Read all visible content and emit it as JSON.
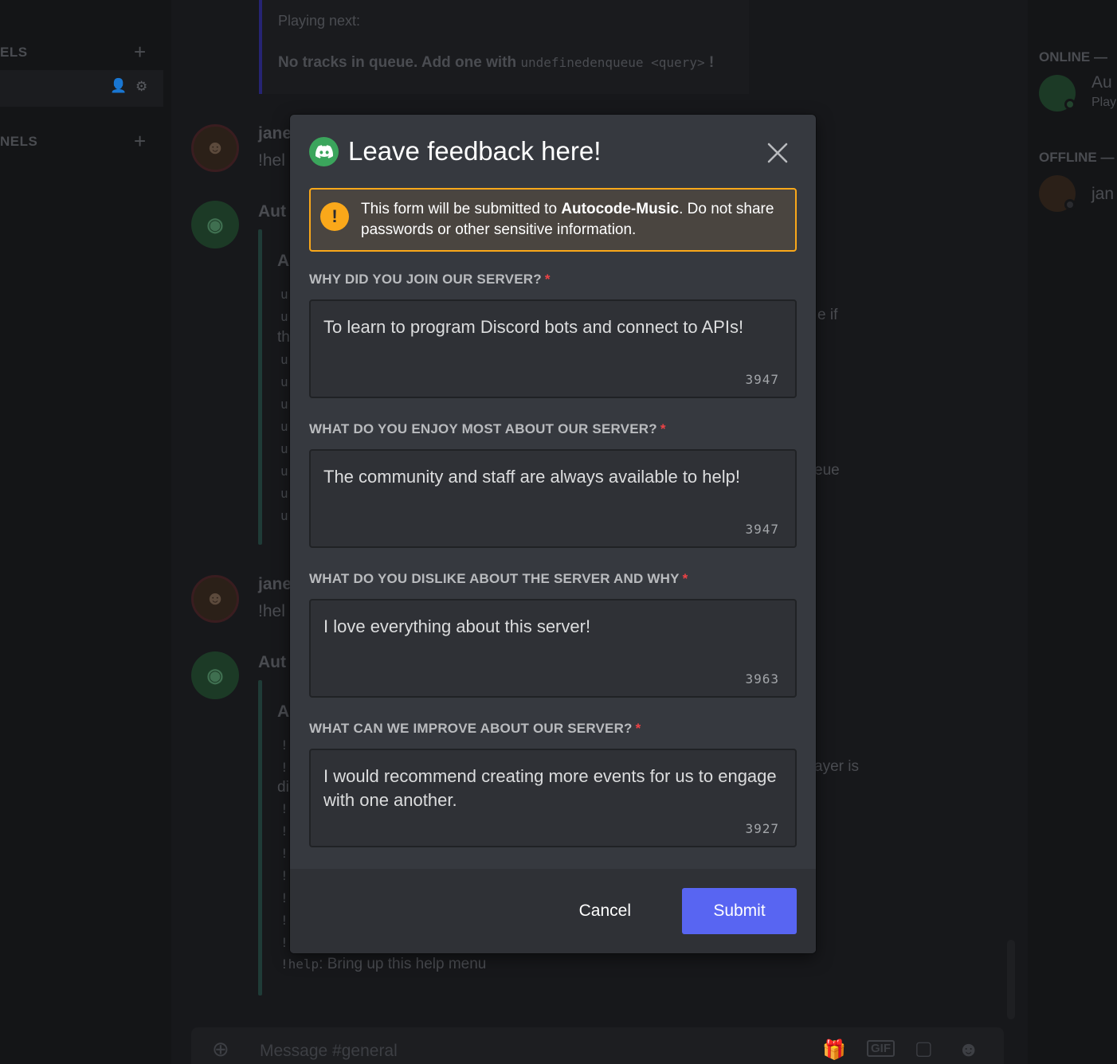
{
  "background": {
    "sidebar": {
      "category_1": "ELS",
      "category_2": "NELS"
    },
    "now_playing": {
      "label": "Playing next:",
      "queue_text": "No tracks in queue. Add one with",
      "queue_cmd": "undefinedenqueue <query>",
      "queue_end": "!"
    },
    "messages": [
      {
        "author": "jane",
        "text": "!hel"
      },
      {
        "author": "Aut",
        "text": "A"
      },
      {
        "author": "jane",
        "text": "!hel"
      },
      {
        "author": "Aut",
        "text": "A"
      }
    ],
    "side_fragments": {
      "frag_1": "e if",
      "frag_2": "eue",
      "frag_3": "ayer is",
      "frag_4": "th",
      "frag_5": "di"
    },
    "help_line": {
      "cmd": "!help",
      "text": ": Bring up this help menu"
    },
    "message_input_placeholder": "Message #general",
    "members": {
      "online_label": "ONLINE —",
      "offline_label": "OFFLINE —",
      "online_member": "Au",
      "online_member_status": "Play",
      "offline_member": "jan"
    },
    "gif_label": "GIF"
  },
  "modal": {
    "title": "Leave feedback here!",
    "warning": {
      "prefix": "This form will be submitted to ",
      "app_name": "Autocode-Music",
      "suffix": ". Do not share passwords or other sensitive information."
    },
    "fields": [
      {
        "label": "WHY DID YOU JOIN OUR SERVER?",
        "required_mark": "*",
        "value": "To learn to program Discord bots and connect to APIs!",
        "remaining": "3947"
      },
      {
        "label": "WHAT DO YOU ENJOY MOST ABOUT OUR SERVER?",
        "required_mark": "*",
        "value": "The community and staff are always available to help!",
        "remaining": "3947"
      },
      {
        "label": "WHAT DO YOU DISLIKE ABOUT THE SERVER AND WHY",
        "required_mark": "*",
        "value": "I love everything about this server!",
        "remaining": "3963"
      },
      {
        "label": "WHAT CAN WE IMPROVE ABOUT OUR SERVER?",
        "required_mark": "*",
        "value": "I would recommend creating more events for us to engage with one another.",
        "remaining": "3927"
      }
    ],
    "cancel_label": "Cancel",
    "submit_label": "Submit"
  },
  "colors": {
    "brand": "#5865f2",
    "warning": "#faa81a",
    "bot_green": "#3ba55c",
    "required": "#ed4245"
  },
  "icons": {
    "close": "close-icon",
    "warning": "warning-icon",
    "bot": "discord-bot-icon"
  }
}
